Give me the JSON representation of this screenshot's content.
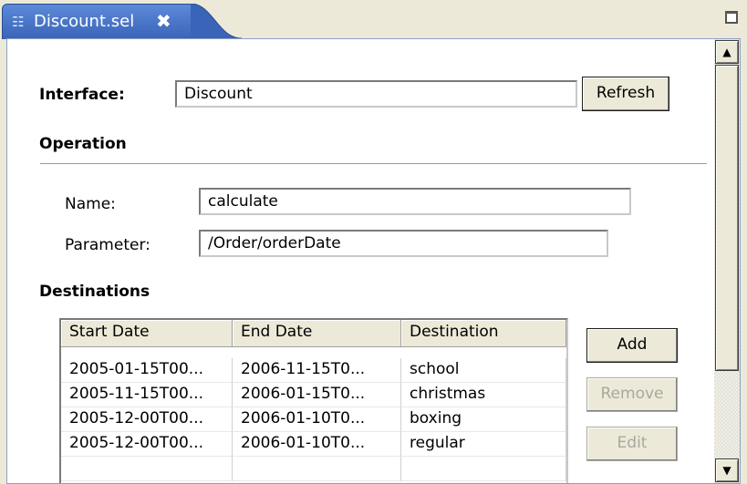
{
  "tab": {
    "icon": "selector-file-icon",
    "label": "Discount.sel",
    "close_icon": "close-icon"
  },
  "window": {
    "maximize_icon": "maximize-icon"
  },
  "interface": {
    "label": "Interface:",
    "value": "Discount",
    "refresh_label": "Refresh"
  },
  "operation": {
    "heading": "Operation",
    "name_label": "Name:",
    "name_value": "calculate",
    "parameter_label": "Parameter:",
    "parameter_value": "/Order/orderDate"
  },
  "destinations": {
    "heading": "Destinations",
    "columns": [
      "Start Date",
      "End Date",
      "Destination"
    ],
    "rows": [
      [
        "2005-01-15T00...",
        "2006-11-15T0...",
        "school"
      ],
      [
        "2005-11-15T00...",
        "2006-01-15T0...",
        "christmas"
      ],
      [
        "2005-12-00T00...",
        "2006-01-10T0...",
        "boxing"
      ],
      [
        "2005-12-00T00...",
        "2006-01-10T0...",
        "regular"
      ]
    ],
    "add_label": "Add",
    "remove_label": "Remove",
    "edit_label": "Edit"
  },
  "scrollbar": {
    "up_icon": "scroll-up-icon",
    "down_icon": "scroll-down-icon"
  }
}
